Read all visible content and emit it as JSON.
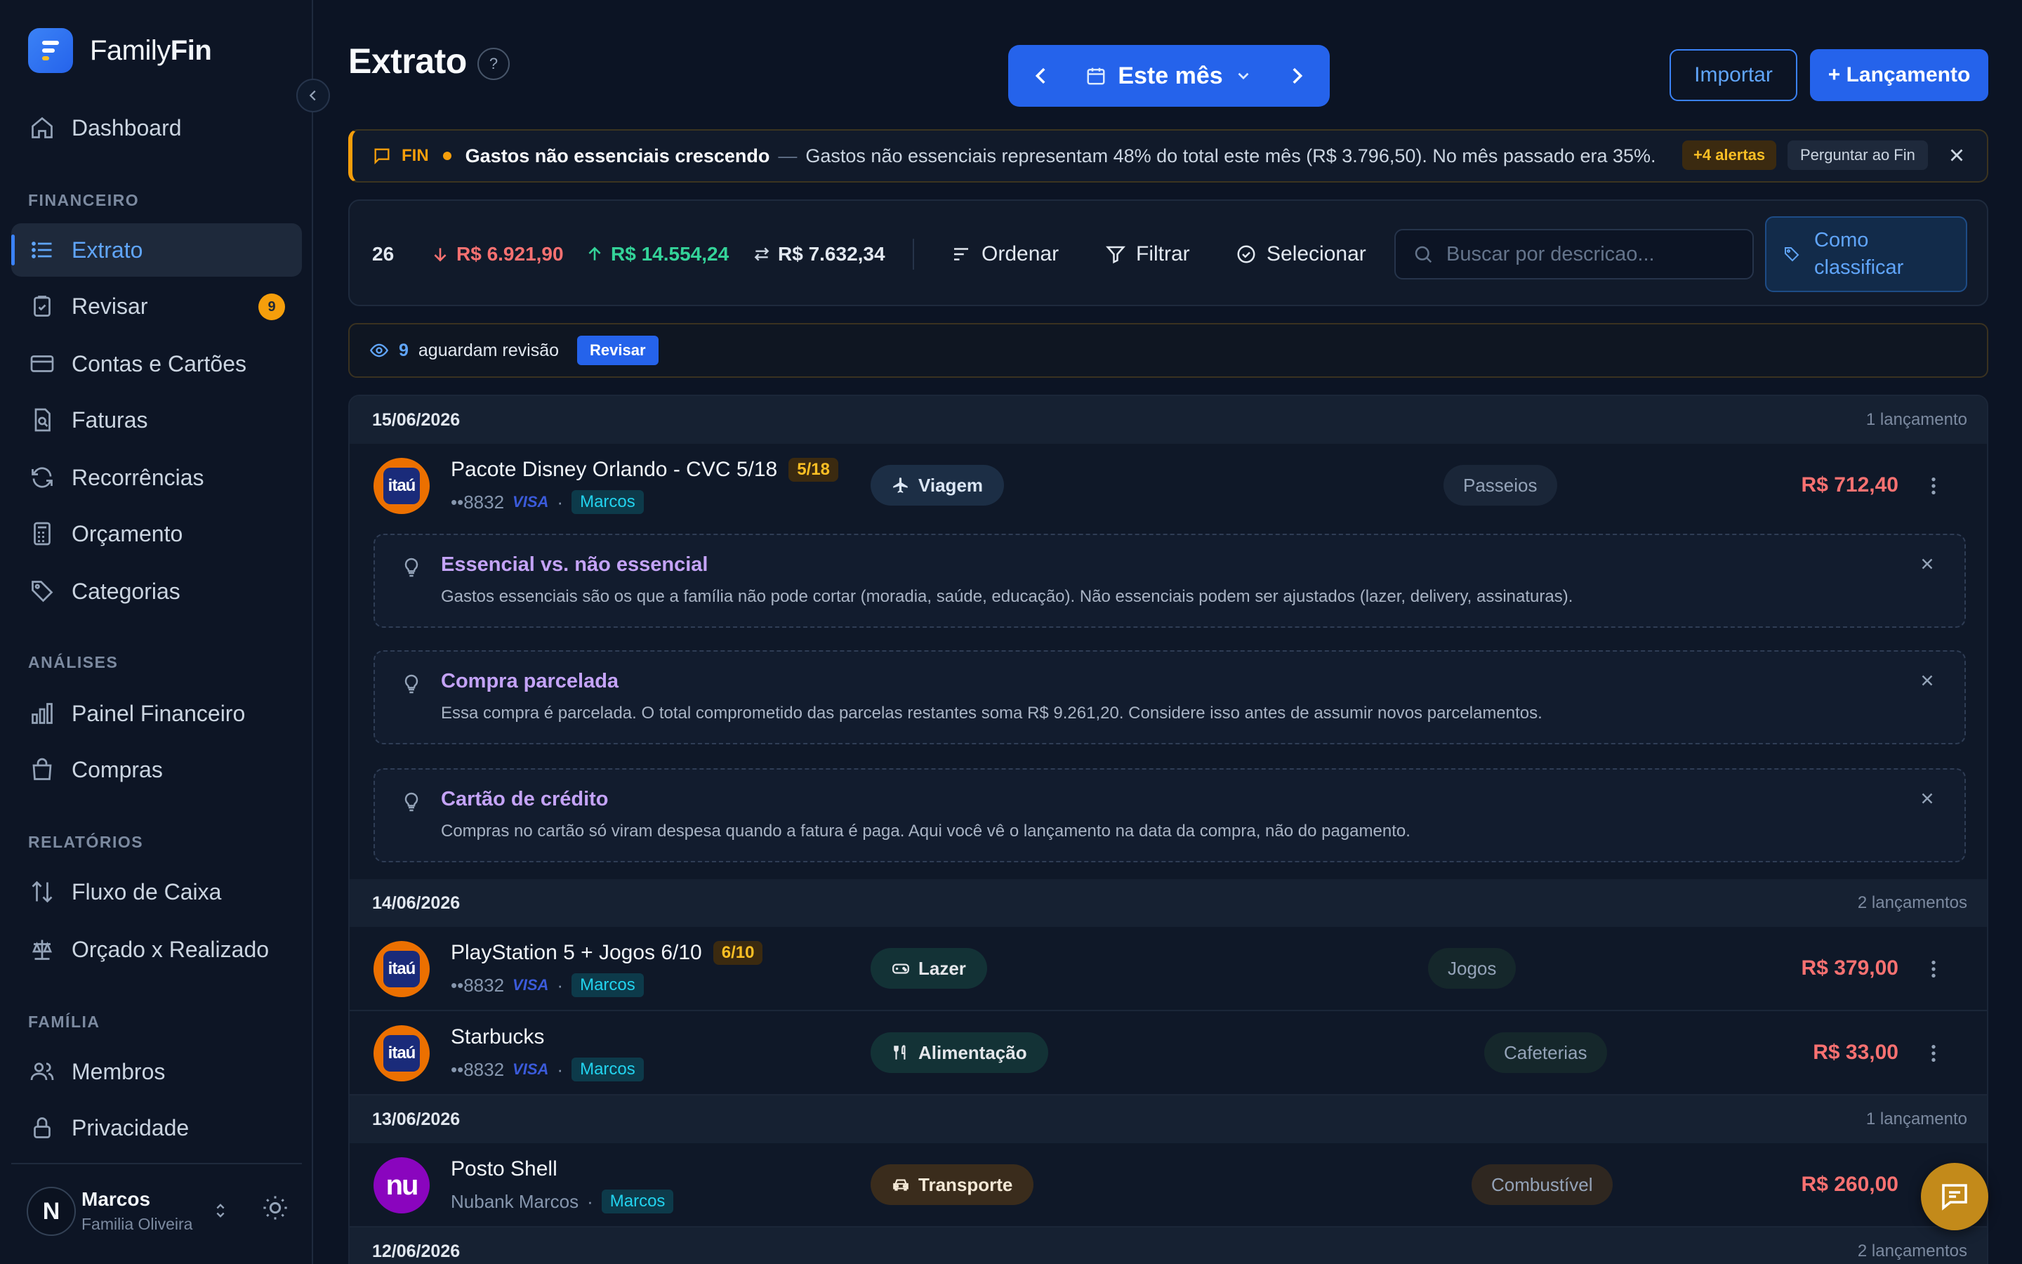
{
  "app": {
    "brand_prefix": "Family",
    "brand_suffix": "Fin"
  },
  "sidebar": {
    "dashboard": "Dashboard",
    "section_financeiro": "FINANCEIRO",
    "extrato": "Extrato",
    "revisar": "Revisar",
    "revisar_badge": "9",
    "contas": "Contas e Cartões",
    "faturas": "Faturas",
    "recorrencias": "Recorrências",
    "orcamento": "Orçamento",
    "categorias": "Categorias",
    "section_analises": "ANÁLISES",
    "painel": "Painel Financeiro",
    "compras": "Compras",
    "section_relatorios": "RELATÓRIOS",
    "fluxo": "Fluxo de Caixa",
    "orcado": "Orçado x Realizado",
    "section_familia": "FAMÍLIA",
    "membros": "Membros",
    "privacidade": "Privacidade"
  },
  "user": {
    "initial": "N",
    "name": "Marcos",
    "family": "Familia Oliveira"
  },
  "header": {
    "title": "Extrato",
    "help": "?",
    "period": "Este mês",
    "import": "Importar",
    "new_entry": "+ Lançamento"
  },
  "alert": {
    "tag": "FIN",
    "title": "Gastos não essenciais crescendo",
    "separator": "—",
    "text": "Gastos não essenciais representam 48% do total este mês (R$ 3.796,50). No mês passado era 35%.",
    "more": "+4 alertas",
    "ask": "Perguntar ao Fin"
  },
  "toolbar": {
    "count": "26",
    "expenses": "R$ 6.921,90",
    "income": "R$ 14.554,24",
    "net": "R$ 7.632,34",
    "order": "Ordenar",
    "filter": "Filtrar",
    "select": "Selecionar",
    "search_placeholder": "Buscar por descricao...",
    "classify_line1": "Como",
    "classify_line2": "classificar"
  },
  "review": {
    "count": "9",
    "text": "aguardam revisão",
    "button": "Revisar"
  },
  "days": [
    {
      "date": "15/06/2026",
      "count": "1 lançamento",
      "transactions": [
        {
          "title": "Pacote Disney Orlando - CVC 5/18",
          "installment": "5/18",
          "account": "••8832",
          "network": "VISA",
          "owner": "Marcos",
          "category": "Viagem",
          "subcategory": "Passeios",
          "amount": "R$ 712,40",
          "bank_logo": "itaú"
        }
      ]
    },
    {
      "date": "14/06/2026",
      "count": "2 lançamentos",
      "transactions": [
        {
          "title": "PlayStation 5 + Jogos 6/10",
          "installment": "6/10",
          "account": "••8832",
          "network": "VISA",
          "owner": "Marcos",
          "category": "Lazer",
          "subcategory": "Jogos",
          "amount": "R$ 379,00",
          "bank_logo": "itaú"
        },
        {
          "title": "Starbucks",
          "account": "••8832",
          "network": "VISA",
          "owner": "Marcos",
          "category": "Alimentação",
          "subcategory": "Cafeterias",
          "amount": "R$ 33,00",
          "bank_logo": "itaú"
        }
      ]
    },
    {
      "date": "13/06/2026",
      "count": "1 lançamento",
      "transactions": [
        {
          "title": "Posto Shell",
          "account": "Nubank Marcos",
          "owner": "Marcos",
          "category": "Transporte",
          "subcategory": "Combustível",
          "amount": "R$ 260,00",
          "bank_logo": "nu"
        }
      ]
    },
    {
      "date": "12/06/2026",
      "count": "2 lançamentos"
    }
  ],
  "tips": [
    {
      "title": "Essencial vs. não essencial",
      "text": "Gastos essenciais são os que a família não pode cortar (moradia, saúde, educação). Não essenciais podem ser ajustados (lazer, delivery, assinaturas)."
    },
    {
      "title": "Compra parcelada",
      "text": "Essa compra é parcelada. O total comprometido das parcelas restantes soma R$ 9.261,20. Considere isso antes de assumir novos parcelamentos."
    },
    {
      "title": "Cartão de crédito",
      "text": "Compras no cartão só viram despesa quando a fatura é paga. Aqui você vê o lançamento na data da compra, não do pagamento."
    }
  ],
  "colors": {
    "accent": "#2563eb",
    "expense": "#f87171",
    "income": "#34d399",
    "warning": "#f59e0b",
    "tip_title": "#c4a3f7",
    "owner_tag": "#22d3ee"
  }
}
